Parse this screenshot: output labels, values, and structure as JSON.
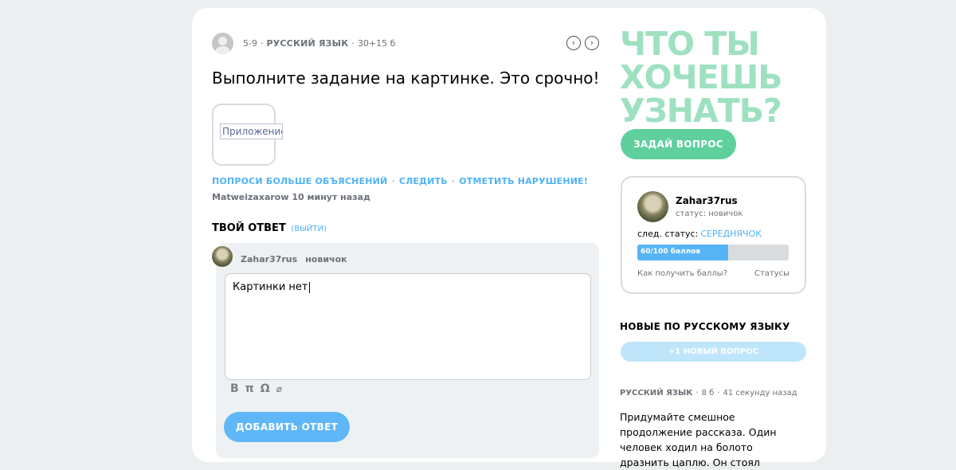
{
  "question": {
    "grade": "5-9",
    "subject": "Русский язык",
    "points": "30+15 б",
    "nav_prev": "‹",
    "nav_next": "›",
    "text": "Выполните задание на картинке. Это срочно!",
    "attachment_alt": "Приложение",
    "actions": {
      "more_explanations": "ПОПРОСИ БОЛЬШЕ ОБЪЯСНЕНИЙ",
      "follow": "СЛЕДИТЬ",
      "report": "ОТМЕТИТЬ НАРУШЕНИЕ!"
    },
    "author": "Matweizaxarow",
    "time_ago": "10 минут назад"
  },
  "answer": {
    "title": "ТВОЙ ОТВЕТ",
    "logout": "(ВЫЙТИ)",
    "username": "Zahar37rus",
    "rank": "новичок",
    "text": "Картинки нет",
    "toolbar": {
      "bold": "B",
      "math": "π",
      "omega": "Ω",
      "attach": "⌀"
    },
    "submit_label": "ДОБАВИТЬ ОТВЕТ"
  },
  "sidebar": {
    "headline": "ЧТО ТЫ ХОЧЕШЬ УЗНАТЬ?",
    "ask_label": "ЗАДАЙ ВОПРОС",
    "profile": {
      "name": "Zahar37rus",
      "status": "статус: новичок",
      "next_status_label": "след. статус:",
      "next_status_value": "СЕРЕДНЯЧОК",
      "progress_label": "60/100 баллов",
      "progress": 0.6,
      "how_to_get_points": "Как получить баллы?",
      "statuses": "Статусы"
    },
    "new_title": "НОВЫЕ ПО РУССКОМУ ЯЗЫКУ",
    "new_question_label": "+1 НОВЫЙ ВОПРОС",
    "feed": {
      "subject": "Русский язык",
      "points": "8 б",
      "time": "41 секунду назад",
      "text": "Придумайте смешное продолжение рассказа. Один человек ходил на болото дразнить цаплю. Он стоял"
    }
  }
}
